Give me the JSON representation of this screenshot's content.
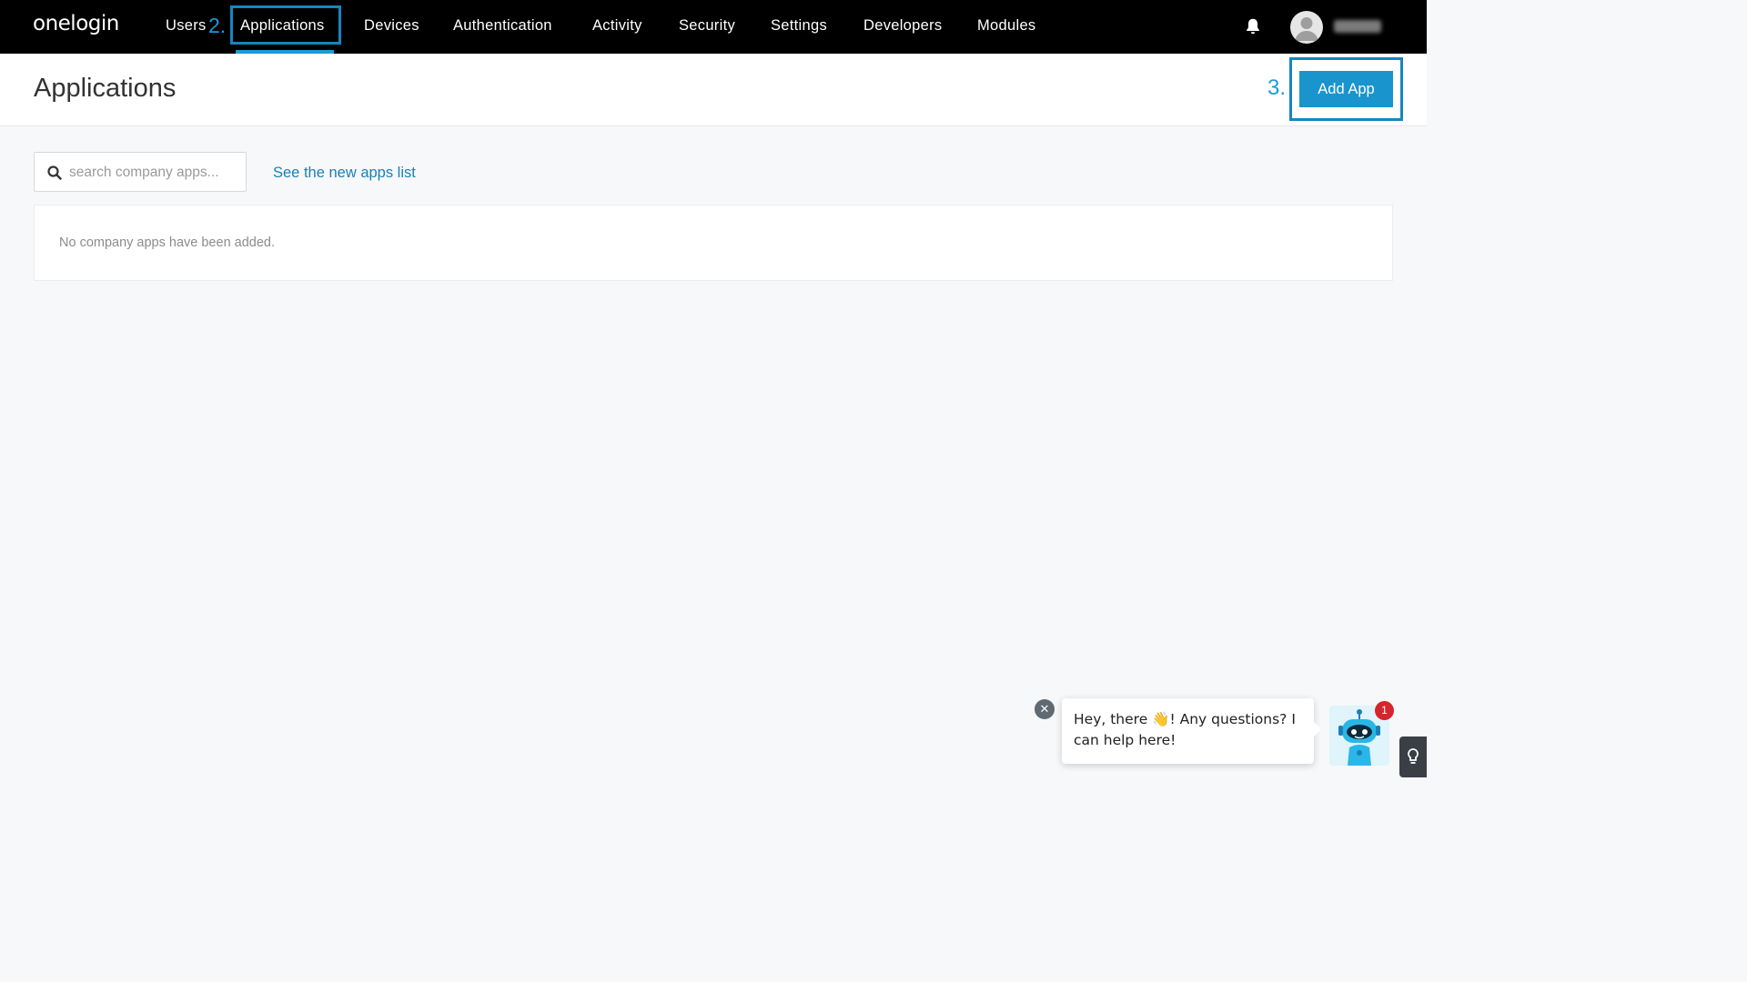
{
  "topbar": {
    "logo": "onelogin",
    "nav": [
      {
        "label": "Users"
      },
      {
        "label": "Applications",
        "active": true
      },
      {
        "label": "Devices"
      },
      {
        "label": "Authentication"
      },
      {
        "label": "Activity"
      },
      {
        "label": "Security"
      },
      {
        "label": "Settings"
      },
      {
        "label": "Developers"
      },
      {
        "label": "Modules"
      }
    ],
    "icons": [
      "bell-icon",
      "avatar"
    ]
  },
  "annotations": {
    "step2": "2.",
    "step3": "3."
  },
  "header": {
    "title": "Applications",
    "add_button": "Add App"
  },
  "toolbar": {
    "search_placeholder": "search company apps...",
    "new_list_link": "See the new apps list"
  },
  "content": {
    "empty_message": "No company apps have been added."
  },
  "chat": {
    "message_start": "Hey, there ",
    "wave_emoji": "👋",
    "message_end": "! Any questions? I can help here!",
    "badge_count": "1"
  },
  "colors": {
    "accent": "#1a94cc",
    "annotation": "#1586bf",
    "topbar": "#000000",
    "badge": "#d6262b"
  }
}
